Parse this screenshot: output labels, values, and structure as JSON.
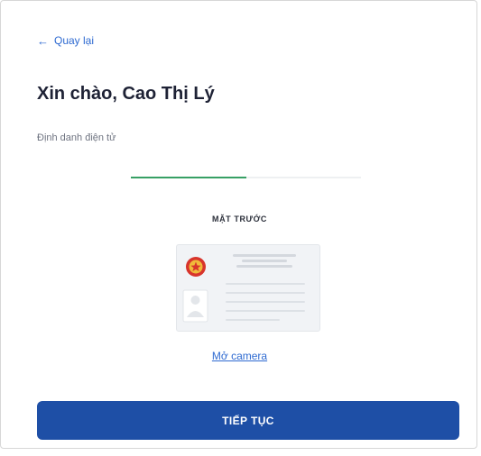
{
  "nav": {
    "back_label": "Quay lại"
  },
  "header": {
    "title": "Xin chào, Cao Thị Lý",
    "subtitle": "Định danh điện tử"
  },
  "progress": {
    "value": 0.5,
    "fill_color": "#37a064",
    "track_color": "#eef0f2"
  },
  "capture": {
    "side_label": "MẶT TRƯỚC",
    "camera_link": "Mở camera"
  },
  "actions": {
    "continue_label": "TIẾP TỤC"
  },
  "colors": {
    "accent": "#1e4fa6",
    "link": "#2e6ad1",
    "title": "#1e2235"
  },
  "icons": {
    "back": "arrow-left-icon",
    "emblem": "national-emblem-icon",
    "portrait": "person-portrait-icon"
  }
}
